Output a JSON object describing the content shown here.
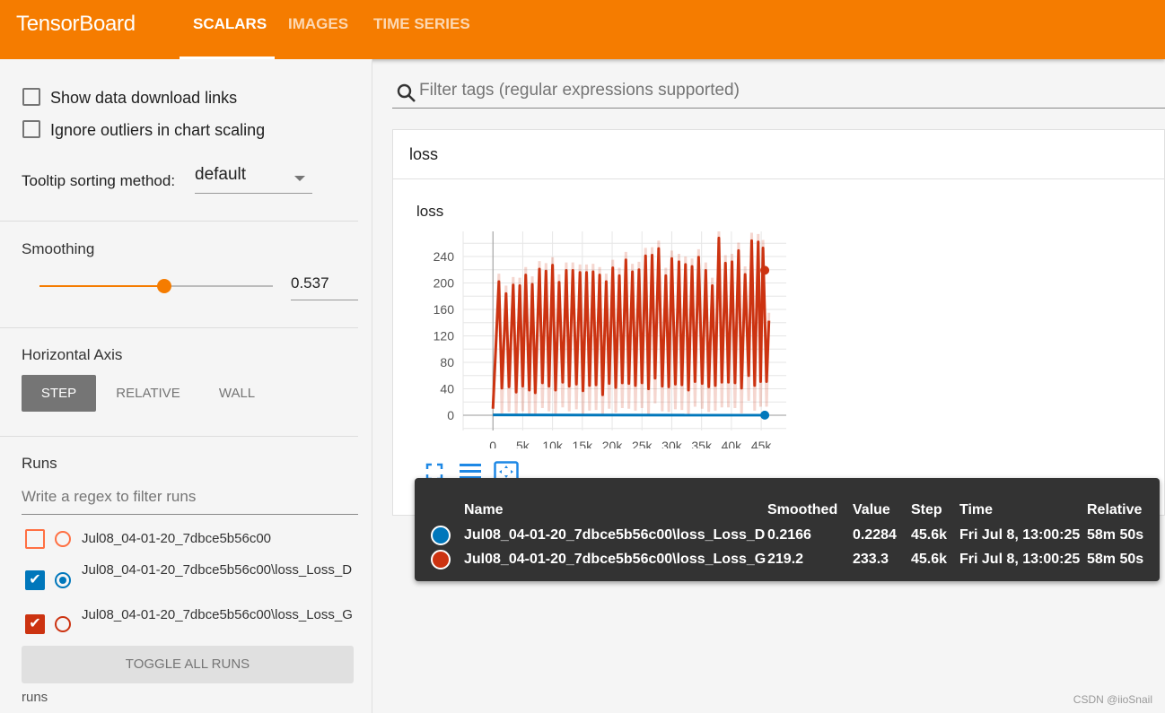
{
  "header": {
    "brand": "TensorBoard",
    "tabs": [
      {
        "label": "SCALARS",
        "active": true
      },
      {
        "label": "IMAGES"
      },
      {
        "label": "TIME SERIES"
      }
    ]
  },
  "sidebar": {
    "show_download_links": {
      "label": "Show data download links",
      "checked": false
    },
    "ignore_outliers": {
      "label": "Ignore outliers in chart scaling",
      "checked": false
    },
    "tooltip_sorting": {
      "label": "Tooltip sorting method:",
      "value": "default"
    },
    "smoothing": {
      "label": "Smoothing",
      "value": "0.537",
      "fraction": 0.537
    },
    "horizontal_axis": {
      "label": "Horizontal Axis",
      "options": [
        "STEP",
        "RELATIVE",
        "WALL"
      ],
      "selected": "STEP"
    },
    "runs": {
      "label": "Runs",
      "filter_placeholder": "Write a regex to filter runs",
      "items": [
        {
          "name": "Jul08_04-01-20_7dbce5b56c00",
          "checked": false,
          "color": "#ff7043"
        },
        {
          "name": "Jul08_04-01-20_7dbce5b56c00\\loss_Loss_D",
          "checked": true,
          "color": "#0077bb"
        },
        {
          "name": "Jul08_04-01-20_7dbce5b56c00\\loss_Loss_G",
          "checked": true,
          "color": "#cc3311"
        }
      ],
      "toggle_label": "TOGGLE ALL RUNS",
      "footer": "runs"
    }
  },
  "main": {
    "filter_placeholder": "Filter tags (regular expressions supported)",
    "group_title": "loss"
  },
  "chart_data": {
    "type": "line",
    "title": "loss",
    "xlim": [
      -5000,
      49200
    ],
    "ylim": [
      -23,
      278
    ],
    "xticks": [
      0,
      5000,
      10000,
      15000,
      20000,
      25000,
      30000,
      35000,
      40000,
      45000
    ],
    "xtick_labels": [
      "0",
      "5k",
      "10k",
      "15k",
      "20k",
      "25k",
      "30k",
      "35k",
      "40k",
      "45k"
    ],
    "yticks": [
      0,
      40,
      80,
      120,
      160,
      200,
      240
    ],
    "grid": true,
    "series": [
      {
        "name": "Jul08_04-01-20_7dbce5b56c00\\loss_Loss_G",
        "color": "#cc3311",
        "peaks": [
          [
            1000,
            202
          ],
          [
            2200,
            184
          ],
          [
            3400,
            197
          ],
          [
            4500,
            196
          ],
          [
            5500,
            212
          ],
          [
            6600,
            198
          ],
          [
            7800,
            221
          ],
          [
            8900,
            218
          ],
          [
            10000,
            227
          ],
          [
            11100,
            201
          ],
          [
            12300,
            219
          ],
          [
            13400,
            219
          ],
          [
            14600,
            216
          ],
          [
            15700,
            216
          ],
          [
            16800,
            217
          ],
          [
            17900,
            212
          ],
          [
            19000,
            202
          ],
          [
            20100,
            223
          ],
          [
            21200,
            211
          ],
          [
            22300,
            235
          ],
          [
            23400,
            217
          ],
          [
            24500,
            220
          ],
          [
            25600,
            241
          ],
          [
            26700,
            242
          ],
          [
            27800,
            252
          ],
          [
            29000,
            211
          ],
          [
            30000,
            237
          ],
          [
            31200,
            232
          ],
          [
            32300,
            228
          ],
          [
            33400,
            225
          ],
          [
            34500,
            239
          ],
          [
            35700,
            219
          ],
          [
            36800,
            196
          ],
          [
            37900,
            268
          ],
          [
            39000,
            230
          ],
          [
            40100,
            232
          ],
          [
            41200,
            249
          ],
          [
            42300,
            213
          ],
          [
            43400,
            264
          ],
          [
            44500,
            262
          ],
          [
            45300,
            253
          ]
        ],
        "troughs": [
          [
            1500,
            41
          ],
          [
            2700,
            43
          ],
          [
            3900,
            35
          ],
          [
            5000,
            44
          ],
          [
            6100,
            38
          ],
          [
            7100,
            34
          ],
          [
            8300,
            49
          ],
          [
            9400,
            44
          ],
          [
            10500,
            38
          ],
          [
            11700,
            50
          ],
          [
            12800,
            44
          ],
          [
            14000,
            47
          ],
          [
            15100,
            37
          ],
          [
            16200,
            45
          ],
          [
            17300,
            46
          ],
          [
            18400,
            31
          ],
          [
            19500,
            48
          ],
          [
            20600,
            42
          ],
          [
            21700,
            49
          ],
          [
            22800,
            48
          ],
          [
            23900,
            45
          ],
          [
            25000,
            49
          ],
          [
            26100,
            40
          ],
          [
            27200,
            56
          ],
          [
            28400,
            44
          ],
          [
            29500,
            43
          ],
          [
            30600,
            47
          ],
          [
            31700,
            46
          ],
          [
            32800,
            38
          ],
          [
            33900,
            51
          ],
          [
            35100,
            48
          ],
          [
            36200,
            43
          ],
          [
            37300,
            45
          ],
          [
            38400,
            50
          ],
          [
            39500,
            50
          ],
          [
            40600,
            49
          ],
          [
            41700,
            41
          ],
          [
            42900,
            60
          ],
          [
            43900,
            45
          ],
          [
            44900,
            51
          ],
          [
            45900,
            51
          ]
        ],
        "start": [
          0,
          10
        ],
        "end": [
          46300,
          143
        ],
        "highlight": {
          "step": 45600,
          "smoothed": 219.2
        }
      },
      {
        "name": "Jul08_04-01-20_7dbce5b56c00\\loss_Loss_D",
        "color": "#0077bb",
        "values": [
          [
            0,
            0.5
          ],
          [
            46300,
            0.2
          ]
        ],
        "highlight": {
          "step": 45600,
          "smoothed": 0.2166
        }
      }
    ]
  },
  "tooltip": {
    "headers": [
      "Name",
      "Smoothed",
      "Value",
      "Step",
      "Time",
      "Relative"
    ],
    "rows": [
      {
        "color": "#0077bb",
        "name": "Jul08_04-01-20_7dbce5b56c00\\loss_Loss_D",
        "smoothed": "0.2166",
        "value": "0.2284",
        "step": "45.6k",
        "time": "Fri Jul 8, 13:00:25",
        "relative": "58m 50s"
      },
      {
        "color": "#cc3311",
        "name": "Jul08_04-01-20_7dbce5b56c00\\loss_Loss_G",
        "smoothed": "219.2",
        "value": "233.3",
        "step": "45.6k",
        "time": "Fri Jul 8, 13:00:25",
        "relative": "58m 50s"
      }
    ]
  },
  "watermark": "CSDN @iioSnail"
}
